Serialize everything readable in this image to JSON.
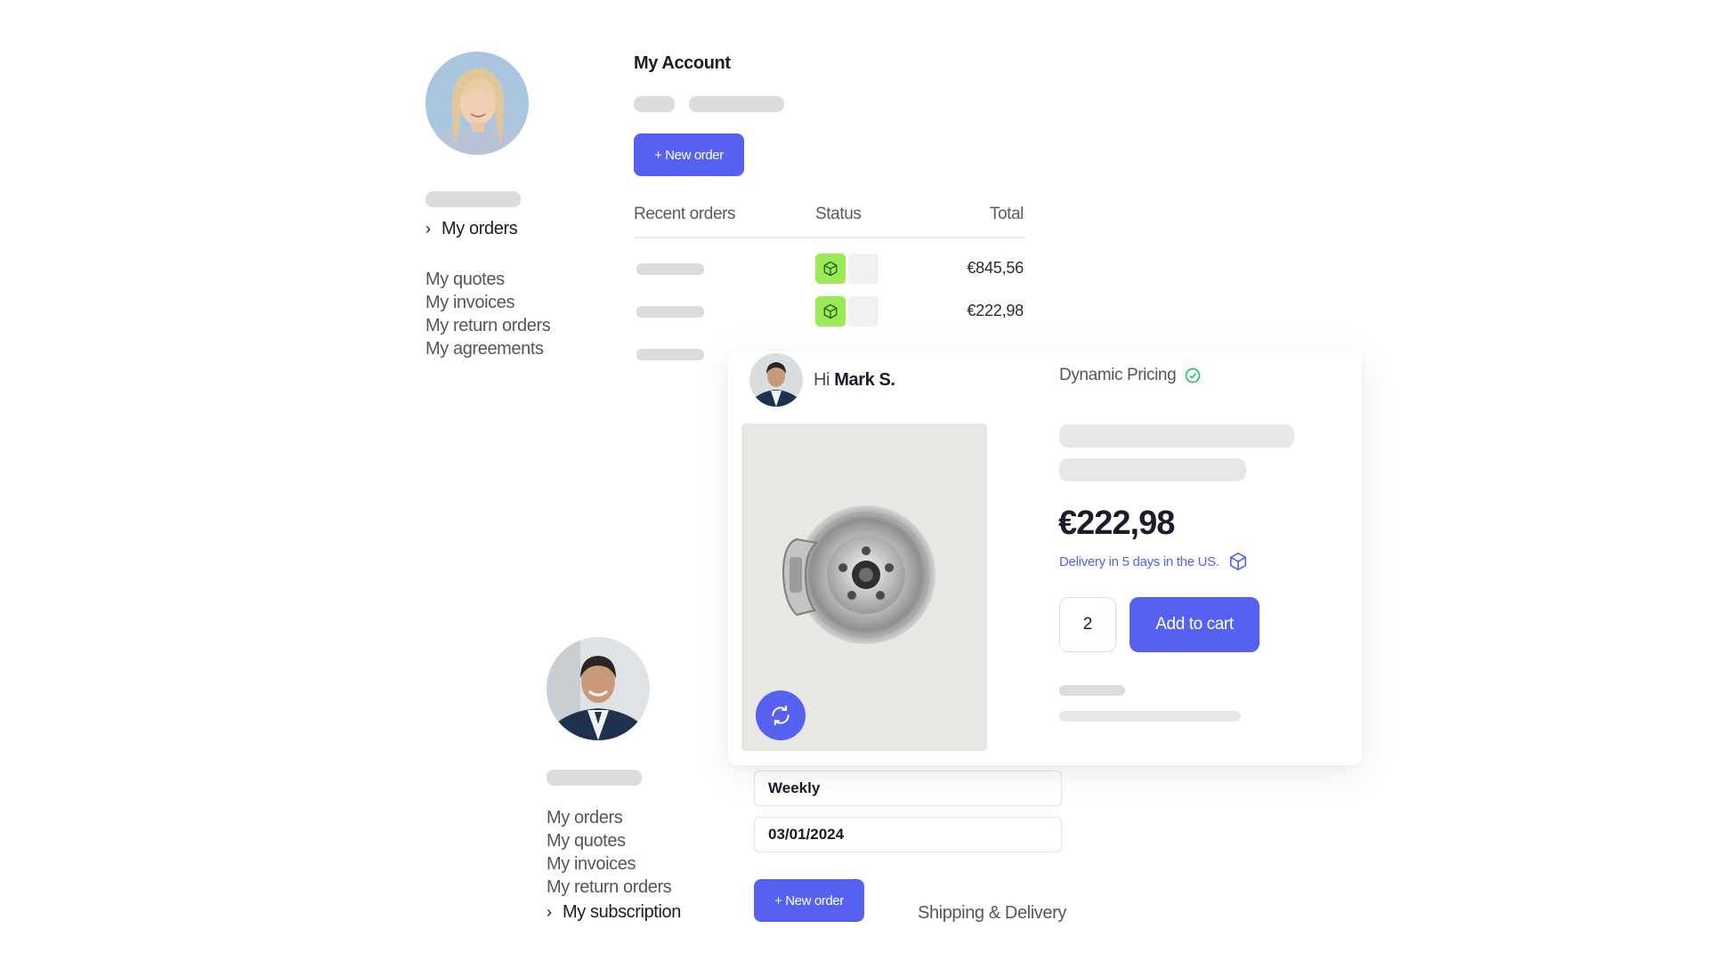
{
  "account": {
    "title": "My Account",
    "new_order_label": "+ New order",
    "nav": {
      "active": "My orders",
      "items": [
        "My quotes",
        "My invoices",
        "My return orders",
        "My agreements"
      ]
    },
    "table": {
      "headers": [
        "Recent orders",
        "Status",
        "Total"
      ],
      "rows": [
        {
          "total": "€845,56"
        },
        {
          "total": "€222,98"
        }
      ]
    }
  },
  "product_card": {
    "greeting_prefix": "Hi ",
    "user_name": "Mark S.",
    "pricing_label": "Dynamic Pricing",
    "price": "€222,98",
    "delivery": "Delivery in 5 days in the US.",
    "quantity": "2",
    "add_to_cart_label": "Add to cart"
  },
  "subscription": {
    "nav": {
      "items": [
        "My orders",
        "My quotes",
        "My invoices",
        "My return orders"
      ],
      "active": "My subscription"
    },
    "frequency": "Weekly",
    "date": "03/01/2024",
    "new_order_label": "+ New order",
    "shipping_label": "Shipping & Delivery"
  },
  "colors": {
    "accent": "#5661f2",
    "status_green": "#9cea58",
    "check_green": "#22c55e",
    "delivery_text": "#5661f2"
  }
}
